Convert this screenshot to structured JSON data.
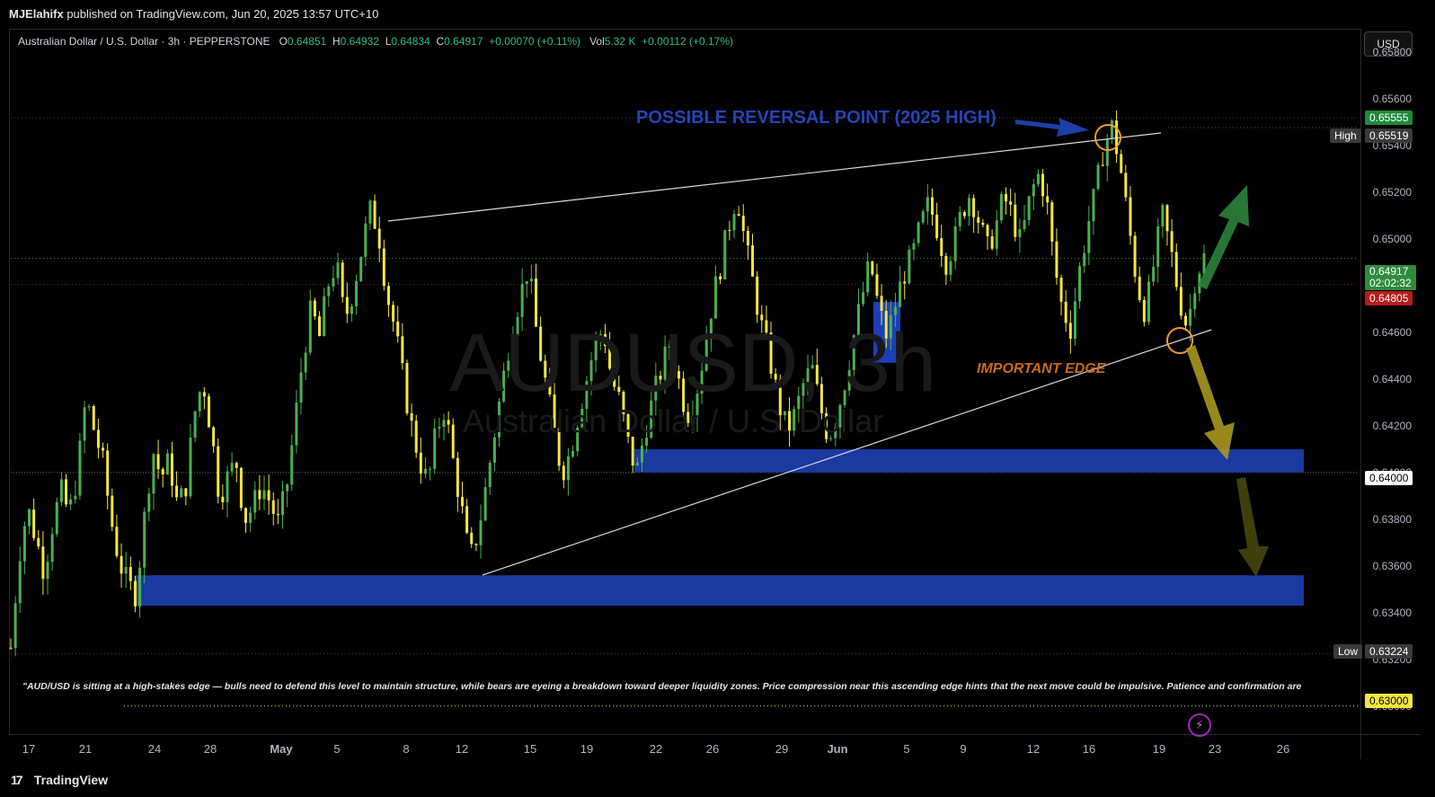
{
  "header": {
    "author": "MJElahifx",
    "published_text": "published on TradingView.com, Jun 20, 2025 13:57 UTC+10"
  },
  "legend": {
    "symbol": "Australian Dollar / U.S. Dollar · 3h · PEPPERSTONE",
    "o_label": "O",
    "o": "0.64851",
    "h_label": "H",
    "h": "0.64932",
    "l_label": "L",
    "l": "0.64834",
    "c_label": "C",
    "c": "0.64917",
    "change": "+0.00070 (+0.11%)",
    "vol_label": "Vol",
    "vol": "5.32 K",
    "vol_change": "+0.00112 (+0.17%)"
  },
  "currency_button": "USD",
  "watermark": {
    "main": "AUDUSD, 3h",
    "sub": "Australian Dollar / U.S. Dollar"
  },
  "annotations": {
    "reversal": "POSSIBLE REVERSAL POINT (2025 HIGH)",
    "edge": "IMPORTANT EDGE"
  },
  "price_tags": {
    "high_label": "High",
    "high": "0.65519",
    "low_label": "Low",
    "low": "0.63224",
    "current": "0.64917",
    "countdown": "02:02:32",
    "bid": "0.64805",
    "level_64": "0.64000",
    "level_63": "0.63000",
    "top_green": "0.65555"
  },
  "note": "\"AUD/USD is sitting at a high-stakes edge — bulls need to defend this level to maintain structure, while bears are eyeing a breakdown toward deeper liquidity zones. Price compression near this ascending edge hints that the next move could be impulsive. Patience and confirmation are",
  "brand": {
    "logo": "17",
    "name": "TradingView"
  },
  "colors": {
    "up": "#26a69a",
    "bull_candle": "#4caf50",
    "bear_candle": "#f5e642",
    "zone": "#1a3aa0",
    "accent": "#2962ff"
  },
  "chart_data": {
    "type": "candlestick",
    "symbol": "AUDUSD",
    "timeframe": "3h",
    "y_axis": {
      "ticks": [
        "0.65800",
        "0.65600",
        "0.65400",
        "0.65200",
        "0.65000",
        "0.64800",
        "0.64600",
        "0.64400",
        "0.64200",
        "0.64000",
        "0.63800",
        "0.63600",
        "0.63400",
        "0.63200",
        "0.63000"
      ],
      "ylim": [
        0.6288,
        0.659
      ]
    },
    "x_axis": {
      "ticks": [
        "17",
        "21",
        "24",
        "28",
        "May",
        "5",
        "8",
        "12",
        "15",
        "19",
        "22",
        "26",
        "29",
        "Jun",
        "5",
        "9",
        "12",
        "16",
        "19",
        "23",
        "26"
      ]
    },
    "close_path": [
      0.6325,
      0.6365,
      0.6385,
      0.6372,
      0.6358,
      0.6378,
      0.6392,
      0.6382,
      0.64,
      0.6432,
      0.6418,
      0.6405,
      0.638,
      0.6362,
      0.6352,
      0.6348,
      0.638,
      0.641,
      0.6398,
      0.6405,
      0.6385,
      0.6395,
      0.6425,
      0.644,
      0.6418,
      0.639,
      0.6398,
      0.6405,
      0.638,
      0.6385,
      0.6395,
      0.6388,
      0.6378,
      0.6392,
      0.642,
      0.645,
      0.647,
      0.6458,
      0.648,
      0.649,
      0.6465,
      0.6478,
      0.6495,
      0.6512,
      0.6505,
      0.6478,
      0.6462,
      0.644,
      0.642,
      0.6405,
      0.6395,
      0.6418,
      0.6428,
      0.6405,
      0.6385,
      0.6362,
      0.6375,
      0.6395,
      0.6418,
      0.644,
      0.6462,
      0.6475,
      0.6488,
      0.646,
      0.644,
      0.642,
      0.64,
      0.6408,
      0.6425,
      0.644,
      0.6455,
      0.6462,
      0.644,
      0.643,
      0.6412,
      0.64,
      0.6418,
      0.6432,
      0.6445,
      0.6455,
      0.644,
      0.6425,
      0.6432,
      0.645,
      0.6472,
      0.6488,
      0.6505,
      0.652,
      0.6498,
      0.648,
      0.6462,
      0.6448,
      0.643,
      0.6418,
      0.6425,
      0.6438,
      0.6445,
      0.6428,
      0.6415,
      0.6425,
      0.644,
      0.6458,
      0.6475,
      0.649,
      0.647,
      0.6458,
      0.6472,
      0.6485,
      0.6492,
      0.6505,
      0.6515,
      0.6505,
      0.649,
      0.6498,
      0.6512,
      0.652,
      0.6508,
      0.6495,
      0.6505,
      0.6518,
      0.651,
      0.6498,
      0.6515,
      0.6528,
      0.652,
      0.649,
      0.647,
      0.6462,
      0.6485,
      0.6505,
      0.652,
      0.654,
      0.6548,
      0.653,
      0.6505,
      0.648,
      0.6468,
      0.649,
      0.651,
      0.6495,
      0.6475,
      0.6462,
      0.6485,
      0.6492
    ],
    "support_zones": [
      {
        "from": 0.64,
        "to": 0.641
      },
      {
        "from": 0.6343,
        "to": 0.6356
      }
    ],
    "highlight_box": {
      "from": 0.6447,
      "to": 0.6473
    },
    "upper_trendline": [
      {
        "x": "May 7",
        "y": 0.6516
      },
      {
        "x": "Jun 17",
        "y": 0.6552
      }
    ],
    "lower_trendline": [
      {
        "x": "May 13",
        "y": 0.6356
      },
      {
        "x": "Jun 20",
        "y": 0.6465
      }
    ],
    "levels": {
      "high": 0.65519,
      "low": 0.63224,
      "current": 0.64917,
      "bid": 0.64805,
      "round": 0.64,
      "round2": 0.63
    }
  }
}
